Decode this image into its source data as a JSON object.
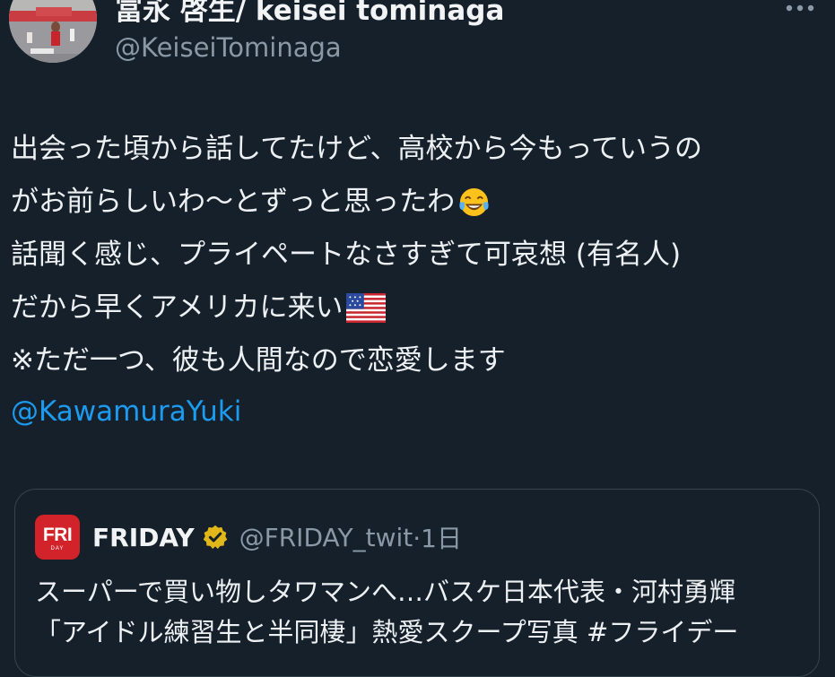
{
  "author": {
    "display_name": "冨永 啓生/ keisei tominaga",
    "handle": "@KeiseiTominaga"
  },
  "tweet": {
    "lines": [
      "出会った頃から話してたけど、高校から今もっていうの",
      "がお前らしいわ〜とずっと思ったわ",
      "話聞く感じ、プライペートなさすぎて可哀想 (有名人)",
      "だから早くアメリカに来い",
      "※ただ一つ、彼も人間なので恋愛します"
    ],
    "emoji_line2": "face-with-tears-of-joy-icon",
    "emoji_line4": "us-flag-icon",
    "mention": "@KawamuraYuki"
  },
  "quote": {
    "logo_text": "FRI",
    "logo_subtext": "DAY",
    "name": "FRIDAY",
    "verified": "gold-verified-badge-icon",
    "handle": "@FRIDAY_twit",
    "time": "·1日",
    "lines": [
      "スーパーで買い物しタワマンへ…バスケ日本代表・河村勇輝",
      "「アイドル練習生と半同棲」熱愛スクープ写真 #フライデー"
    ]
  },
  "colors": {
    "background": "#15202b",
    "link": "#1d9bf0",
    "secondary_text": "#8b98a5",
    "border": "#38444d",
    "friday_red": "#d2232a",
    "verified_gold": "#e2b719"
  }
}
